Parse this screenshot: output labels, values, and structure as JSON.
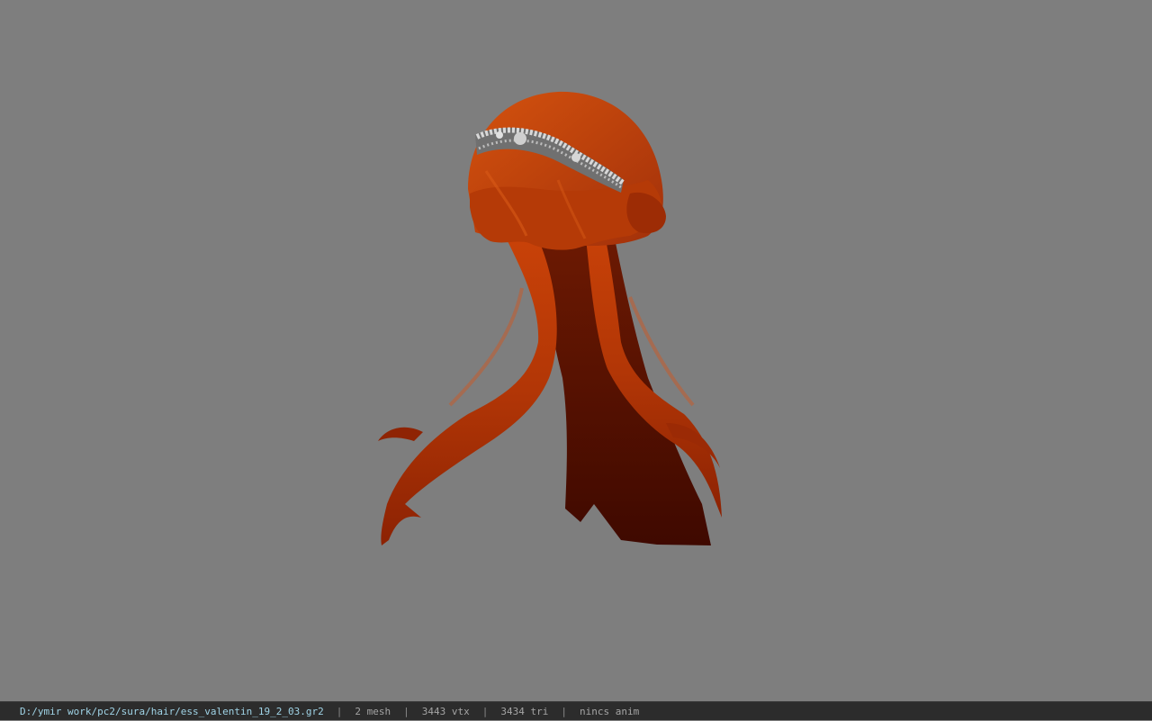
{
  "viewport": {
    "background_color": "#7e7e7e",
    "model": {
      "icon": "hair-model-render",
      "hair_color": "#c33a06",
      "hair_shadow_color": "#4a0c00",
      "headband_color": "#bfbfbf"
    }
  },
  "statusbar": {
    "file_path": "D:/ymir work/pc2/sura/hair/ess_valentin_19_2_03.gr2",
    "separator": "|",
    "mesh": "2 mesh",
    "vertices": "3443 vtx",
    "triangles": "3434 tri",
    "anim": "nincs anim"
  }
}
